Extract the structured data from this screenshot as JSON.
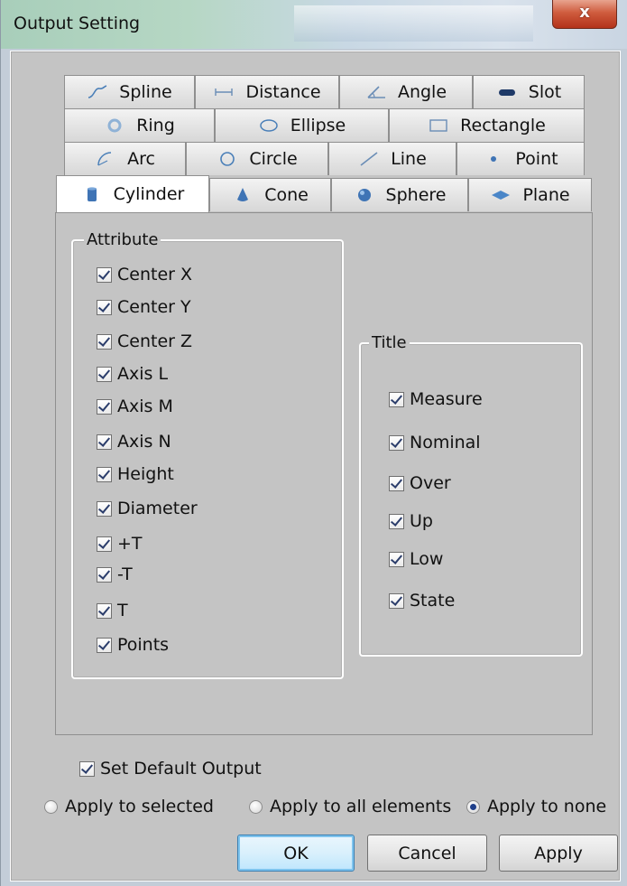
{
  "window": {
    "title": "Output Setting",
    "close_glyph": "x"
  },
  "tabs": {
    "row1": [
      {
        "label": "Spline",
        "icon": "spline-icon"
      },
      {
        "label": "Distance",
        "icon": "distance-icon"
      },
      {
        "label": "Angle",
        "icon": "angle-icon"
      },
      {
        "label": "Slot",
        "icon": "slot-icon"
      }
    ],
    "row2": [
      {
        "label": "Ring",
        "icon": "ring-icon"
      },
      {
        "label": "Ellipse",
        "icon": "ellipse-icon"
      },
      {
        "label": "Rectangle",
        "icon": "rectangle-icon"
      }
    ],
    "row3": [
      {
        "label": "Arc",
        "icon": "arc-icon"
      },
      {
        "label": "Circle",
        "icon": "circle-icon"
      },
      {
        "label": "Line",
        "icon": "line-icon"
      },
      {
        "label": "Point",
        "icon": "point-icon"
      }
    ],
    "row4": [
      {
        "label": "Cylinder",
        "icon": "cylinder-icon",
        "active": true
      },
      {
        "label": "Cone",
        "icon": "cone-icon"
      },
      {
        "label": "Sphere",
        "icon": "sphere-icon"
      },
      {
        "label": "Plane",
        "icon": "plane-icon"
      }
    ]
  },
  "attribute_group": {
    "legend": "Attribute",
    "items": [
      {
        "label": "Center X",
        "checked": true
      },
      {
        "label": "Center Y",
        "checked": true
      },
      {
        "label": "Center Z",
        "checked": true
      },
      {
        "label": "Axis L",
        "checked": true
      },
      {
        "label": "Axis M",
        "checked": true
      },
      {
        "label": "Axis N",
        "checked": true
      },
      {
        "label": "Height",
        "checked": true
      },
      {
        "label": "Diameter",
        "checked": true
      },
      {
        "label": "+T",
        "checked": true
      },
      {
        "label": "-T",
        "checked": true
      },
      {
        "label": "T",
        "checked": true
      },
      {
        "label": "Points",
        "checked": true
      }
    ]
  },
  "title_group": {
    "legend": "Title",
    "items": [
      {
        "label": "Measure",
        "checked": true
      },
      {
        "label": "Nominal",
        "checked": true
      },
      {
        "label": "Over",
        "checked": true
      },
      {
        "label": "Up",
        "checked": true
      },
      {
        "label": "Low",
        "checked": true
      },
      {
        "label": "State",
        "checked": true
      }
    ]
  },
  "default_output": {
    "label": "Set Default Output",
    "checked": true
  },
  "apply_scope": [
    {
      "label": "Apply to selected",
      "selected": false
    },
    {
      "label": "Apply to all elements",
      "selected": false
    },
    {
      "label": "Apply to none",
      "selected": true
    }
  ],
  "buttons": {
    "ok": "OK",
    "cancel": "Cancel",
    "apply": "Apply"
  },
  "colors": {
    "dialog_background": "#c4c4c4",
    "close_button": "#cf5c3e",
    "check_mark": "#2b3d6b",
    "default_button_border": "#3c7fb1"
  }
}
